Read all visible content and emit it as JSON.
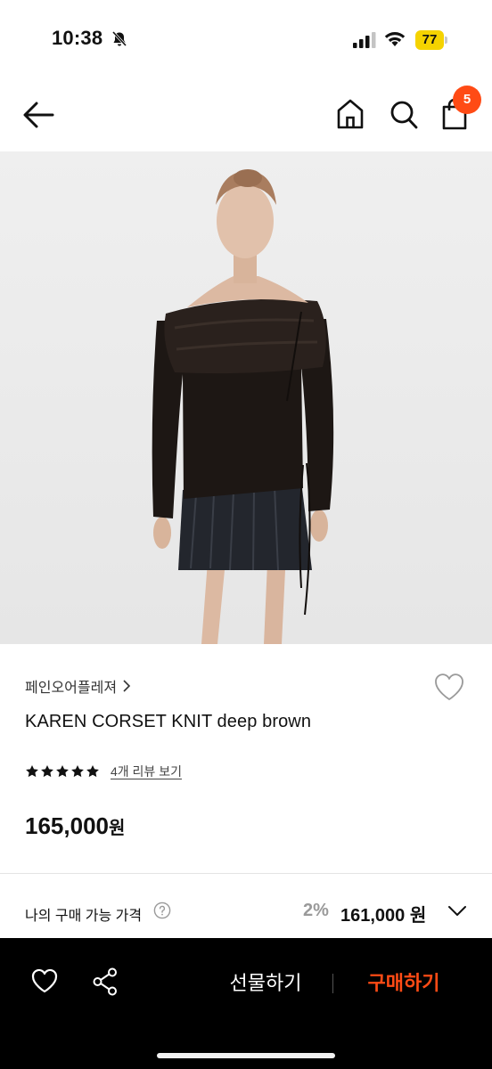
{
  "status_bar": {
    "time": "10:38",
    "battery": "77",
    "icons": [
      "bell-slash-icon",
      "signal-icon",
      "wifi-icon",
      "battery-icon"
    ]
  },
  "nav": {
    "icons": [
      "back-arrow-icon",
      "home-icon",
      "search-icon",
      "shopping-bag-icon"
    ],
    "cart_badge": "5"
  },
  "product": {
    "brand": "페인오어플레져",
    "title": "KAREN CORSET KNIT deep brown",
    "rating_stars": 5,
    "review_link": "4개 리뷰 보기",
    "price": "165,000",
    "price_unit": "원"
  },
  "purchase": {
    "label": "나의 구매 가능 가격",
    "discount_rate": "2%",
    "discount_price": "161,000 원"
  },
  "bottom_bar": {
    "gift_label": "선물하기",
    "buy_label": "구매하기"
  },
  "colors": {
    "accent": "#ff4b15",
    "bottom_bar": "#000000",
    "battery": "#f5d300",
    "muted": "#9a9a9a"
  }
}
